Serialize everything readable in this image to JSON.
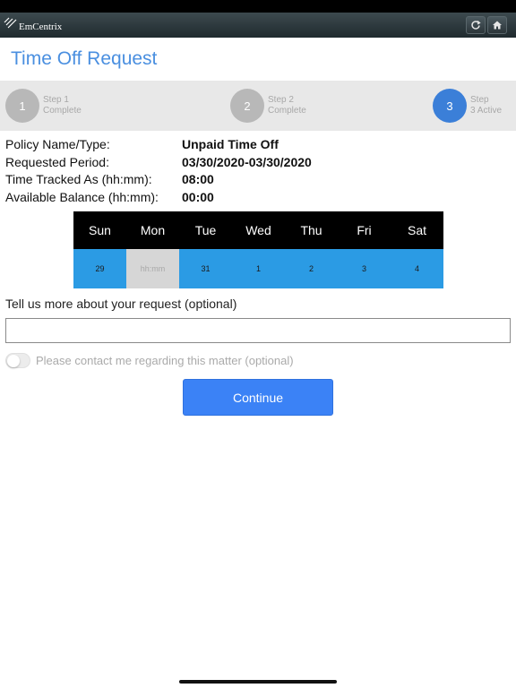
{
  "app": {
    "name": "EmCentrix",
    "logo_icon": "emcentrix-logo-icon",
    "refresh_icon": "refresh-icon",
    "home_icon": "home-icon"
  },
  "page": {
    "title": "Time Off Request"
  },
  "steps": [
    {
      "number": "1",
      "label": "Step 1",
      "status": "Complete",
      "state": "complete"
    },
    {
      "number": "2",
      "label": "Step 2",
      "status": "Complete",
      "state": "complete"
    },
    {
      "number": "3",
      "label": "Step",
      "status": "3 Active",
      "state": "active"
    }
  ],
  "details": {
    "policy_label": "Policy Name/Type:",
    "policy_value": "Unpaid Time Off",
    "period_label": "Requested Period:",
    "period_value": "03/30/2020-03/30/2020",
    "tracked_label": "Time Tracked As (hh:mm):",
    "tracked_value": "08:00",
    "balance_label": "Available Balance (hh:mm):",
    "balance_value": "00:00"
  },
  "calendar": {
    "days": [
      "Sun",
      "Mon",
      "Tue",
      "Wed",
      "Thu",
      "Fri",
      "Sat"
    ],
    "cells": [
      "29",
      "hh:mm",
      "31",
      "1",
      "2",
      "3",
      "4"
    ]
  },
  "form": {
    "request_label": "Tell us more about your request (optional)",
    "request_value": "",
    "contact_label": "Please contact me regarding this matter (optional)",
    "contact_on": false,
    "continue_label": "Continue"
  },
  "colors": {
    "accent": "#3b82f6",
    "title": "#4a8fe0",
    "step_active": "#3b7fd8",
    "calendar_header": "#000000",
    "calendar_body": "#2b9be4"
  }
}
